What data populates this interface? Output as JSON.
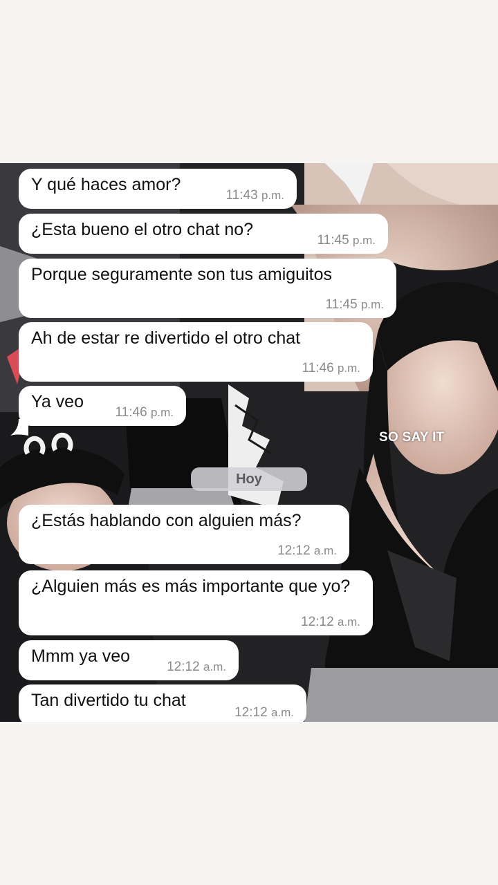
{
  "chat": {
    "day_separator": "Hoy",
    "overlay_caption": "SO SAY IT",
    "messages": [
      {
        "text": "Y qué haces amor?",
        "time": "11:43",
        "ampm": "p.m."
      },
      {
        "text": "¿Esta bueno el otro chat no?",
        "time": "11:45",
        "ampm": "p.m."
      },
      {
        "text": "Porque seguramente son tus amiguitos",
        "time": "11:45",
        "ampm": "p.m."
      },
      {
        "text": "Ah de estar re divertido el otro chat",
        "time": "11:46",
        "ampm": "p.m."
      },
      {
        "text": "Ya veo",
        "time": "11:46",
        "ampm": "p.m."
      },
      {
        "text": "¿Estás hablando con alguien más?",
        "time": "12:12",
        "ampm": "a.m."
      },
      {
        "text": "¿Alguien más es más importante que yo?",
        "time": "12:12",
        "ampm": "a.m."
      },
      {
        "text": "Mmm ya veo",
        "time": "12:12",
        "ampm": "a.m."
      },
      {
        "text": "Tan divertido tu chat",
        "time": "12:12",
        "ampm": "a.m."
      }
    ]
  },
  "colors": {
    "bubble": "#ffffff",
    "timestamp": "#8a8a8e",
    "background": "#f6f3f3"
  }
}
